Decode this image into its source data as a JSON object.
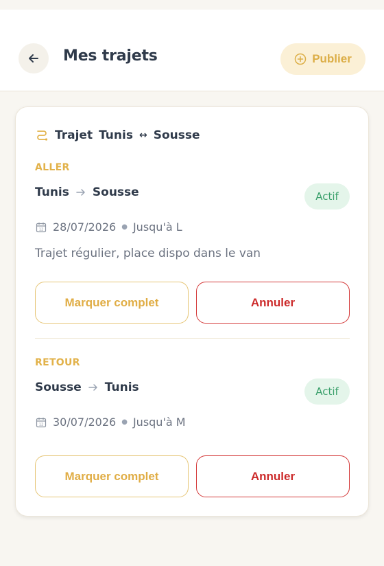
{
  "header": {
    "title": "Mes trajets",
    "publish_label": "Publier"
  },
  "trip": {
    "title_prefix": "Trajet",
    "origin": "Tunis",
    "exchange_symbol": "↔",
    "destination": "Sousse"
  },
  "outbound": {
    "label": "ALLER",
    "from": "Tunis",
    "to": "Sousse",
    "status": "Actif",
    "date": "28/07/2026",
    "until": "Jusqu'à L",
    "description": "Trajet régulier, place dispo dans le van",
    "complete_label": "Marquer complet",
    "cancel_label": "Annuler"
  },
  "return": {
    "label": "RETOUR",
    "from": "Sousse",
    "to": "Tunis",
    "status": "Actif",
    "date": "30/07/2026",
    "until": "Jusqu'à M",
    "complete_label": "Marquer complet",
    "cancel_label": "Annuler"
  },
  "colors": {
    "accent": "#e2b24a",
    "status_green": "#3aa06b",
    "danger": "#cc2a2a"
  },
  "icons": {
    "back": "arrow-left-icon",
    "publish": "plus-circle-icon",
    "route": "route-icon",
    "calendar": "calendar-icon"
  }
}
